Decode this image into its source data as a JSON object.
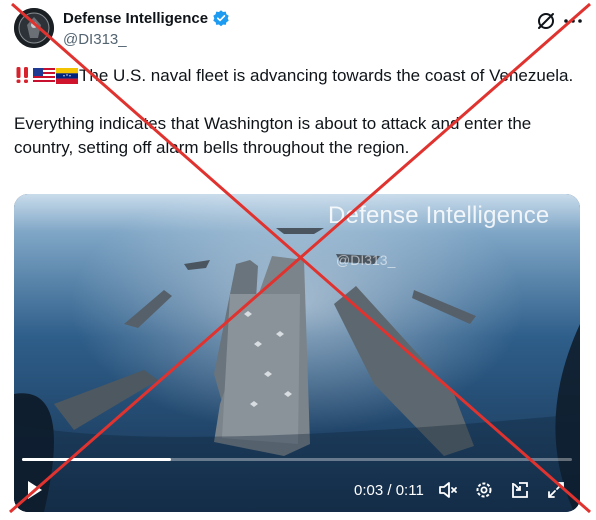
{
  "author": {
    "display_name": "Defense Intelligence",
    "handle": "@DI313_"
  },
  "tweet": {
    "line1_emoji": [
      "double-exclamation",
      "us-flag",
      "venezuela-flag"
    ],
    "line1_text": "The U.S. naval fleet is advancing towards the coast of Venezuela.",
    "line2_text": "Everything indicates that Washington is about to attack and enter the country, setting off alarm bells throughout the region."
  },
  "video": {
    "watermark": "Defense Intelligence",
    "watermark_handle": "@DI313_",
    "current_time": "0:03",
    "separator": " / ",
    "duration": "0:11",
    "progress_fraction": 0.27
  },
  "overlay": {
    "cross_color": "#e0332f"
  },
  "colors": {
    "verified_blue": "#1d9bf0",
    "secondary_text": "#536471",
    "primary_text": "#0f1419"
  },
  "icons": [
    "grok-icon",
    "more-icon",
    "play-icon",
    "mute-icon",
    "settings-icon",
    "pip-icon",
    "fullscreen-icon",
    "verified-badge-icon"
  ]
}
